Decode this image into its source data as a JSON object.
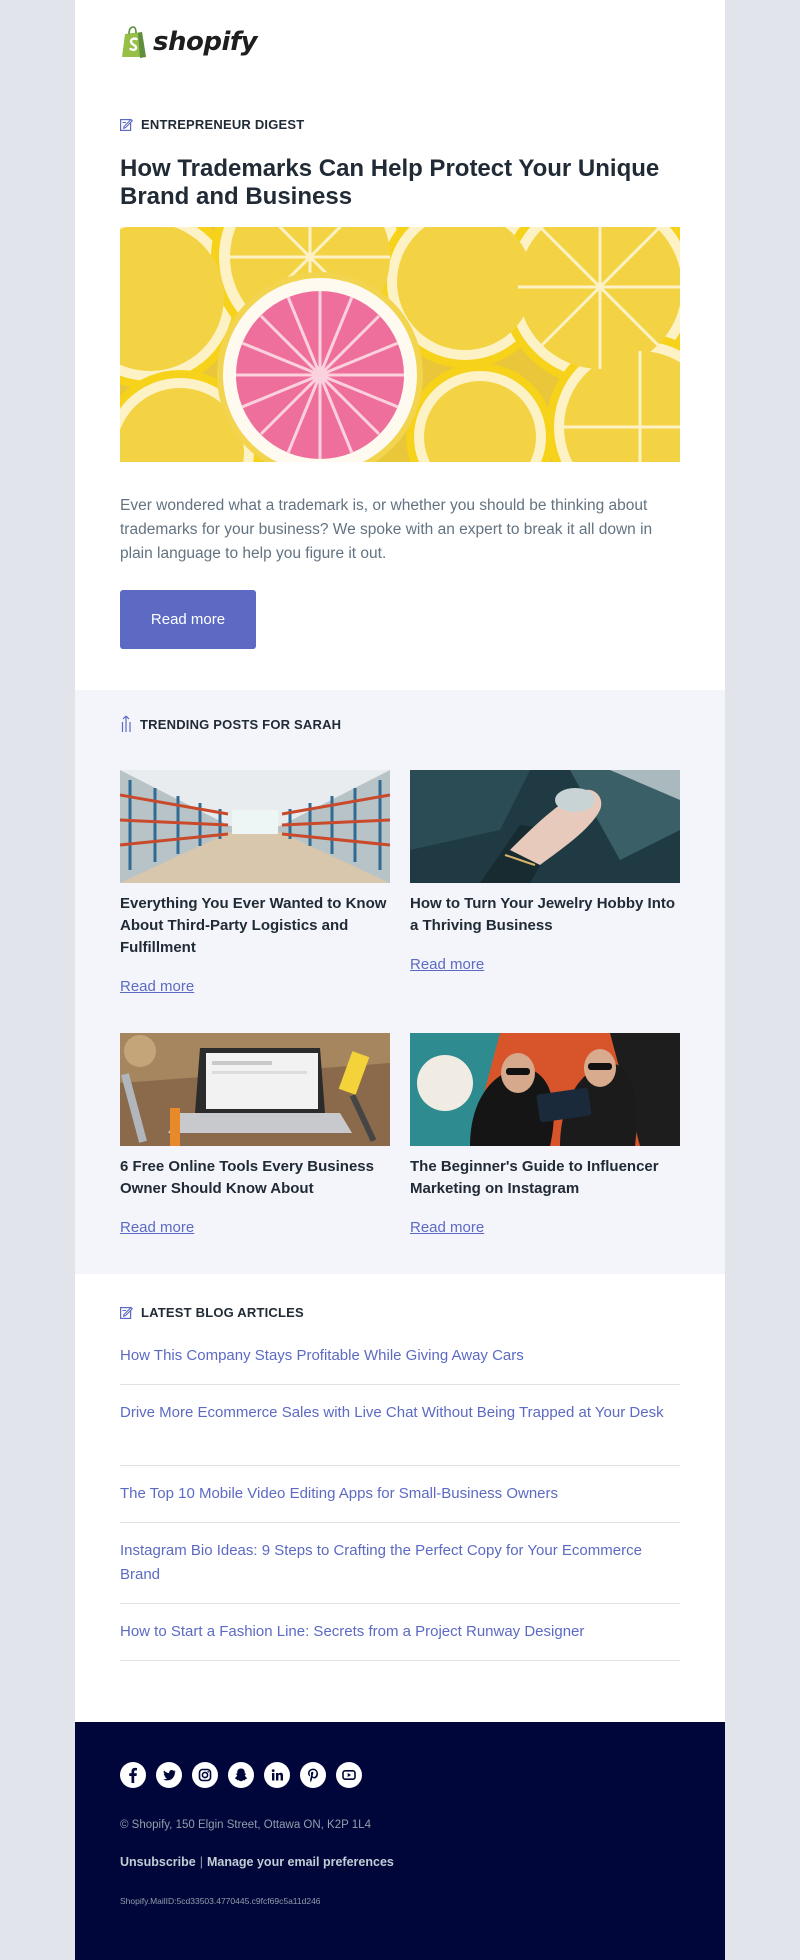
{
  "brand": {
    "name": "shopify",
    "accent": "#5c6ac4",
    "bag_green": "#95bf47",
    "footer_bg": "#000639"
  },
  "hero": {
    "section_label": "ENTREPRENEUR DIGEST",
    "section_icon": "edit-icon",
    "title": "How Trademarks Can Help Protect Your Unique Brand and Business",
    "image": "lemons-and-grapefruit-slices",
    "body": "Ever wondered what a trademark is, or whether you should be thinking about trademarks for your business? We spoke with an expert to break it all down in plain language to help you figure it out.",
    "cta": "Read more"
  },
  "trending": {
    "section_label": "TRENDING POSTS FOR SARAH",
    "section_icon": "trending-arrows-icon",
    "posts": [
      {
        "image": "warehouse-shelves",
        "title": "Everything You Ever Wanted to Know About Third-Party Logistics and Fulfillment",
        "link": "Read more"
      },
      {
        "image": "hand-with-jewelry",
        "title": "How to Turn Your Jewelry Hobby Into a Thriving Business",
        "link": "Read more"
      },
      {
        "image": "laptop-with-tools",
        "title": "6 Free Online Tools Every Business Owner Should Know About",
        "link": "Read more"
      },
      {
        "image": "two-women-selfie",
        "title": "The Beginner's Guide to Influencer Marketing on Instagram",
        "link": "Read more"
      }
    ]
  },
  "blog": {
    "section_label": "LATEST BLOG ARTICLES",
    "section_icon": "edit-icon",
    "articles": [
      "How This Company Stays Profitable While Giving Away Cars",
      "Drive More Ecommerce Sales with Live Chat Without Being Trapped at Your Desk",
      "The Top 10 Mobile Video Editing Apps for Small-Business Owners",
      "Instagram Bio Ideas: 9 Steps to Crafting the Perfect Copy for Your Ecommerce Brand",
      "How to Start a Fashion Line: Secrets from a Project Runway Designer"
    ]
  },
  "footer": {
    "social": [
      "facebook-icon",
      "twitter-icon",
      "instagram-icon",
      "snapchat-icon",
      "linkedin-icon",
      "pinterest-icon",
      "youtube-icon"
    ],
    "address": "© Shopify,  150 Elgin Street, Ottawa ON, K2P 1L4",
    "unsubscribe": "Unsubscribe",
    "separator": "|",
    "manage": "Manage your email preferences",
    "mail_id": "Shopify.MailID:5cd33503.4770445.c9fcf69c5a11d246"
  }
}
